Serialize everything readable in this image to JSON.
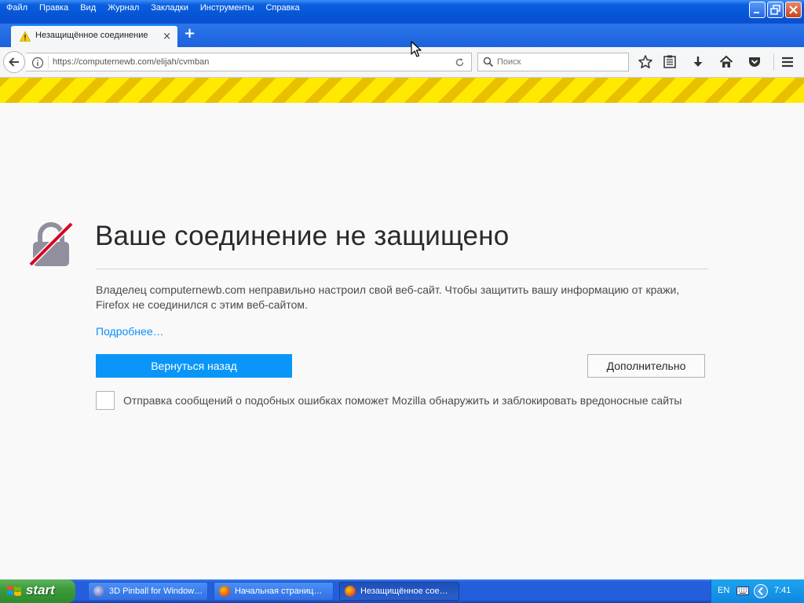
{
  "menu": {
    "items": [
      {
        "label": "Файл"
      },
      {
        "label": "Правка"
      },
      {
        "label": "Вид"
      },
      {
        "label": "Журнал"
      },
      {
        "label": "Закладки"
      },
      {
        "label": "Инструменты"
      },
      {
        "label": "Справка"
      }
    ]
  },
  "tab": {
    "title": "Незащищённое соединение",
    "close": "×",
    "new_tab": "+"
  },
  "navbar": {
    "url": "https://computernewb.com/elijah/cvmban",
    "search_placeholder": "Поиск"
  },
  "page": {
    "title": "Ваше соединение не защищено",
    "description": "Владелец computernewb.com неправильно настроил свой веб-сайт. Чтобы защитить вашу информацию от кражи, Firefox не соединился с этим веб-сайтом.",
    "learn_more": "Подробнее…",
    "go_back": "Вернуться назад",
    "advanced": "Дополнительно",
    "report_text": "Отправка сообщений о подобных ошибках поможет Mozilla обнаружить и заблокировать вредоносные сайты"
  },
  "taskbar": {
    "start_label": "start",
    "tasks": [
      {
        "label": "3D Pinball for Window…"
      },
      {
        "label": "Начальная страниц…"
      },
      {
        "label": "Незащищённое сое…"
      }
    ],
    "language": "EN",
    "clock": "7:41"
  },
  "colors": {
    "accent": "#0996f8",
    "link": "#0a8dff",
    "stripe_yellow": "#ffe900",
    "lock_strike": "#d70022"
  }
}
